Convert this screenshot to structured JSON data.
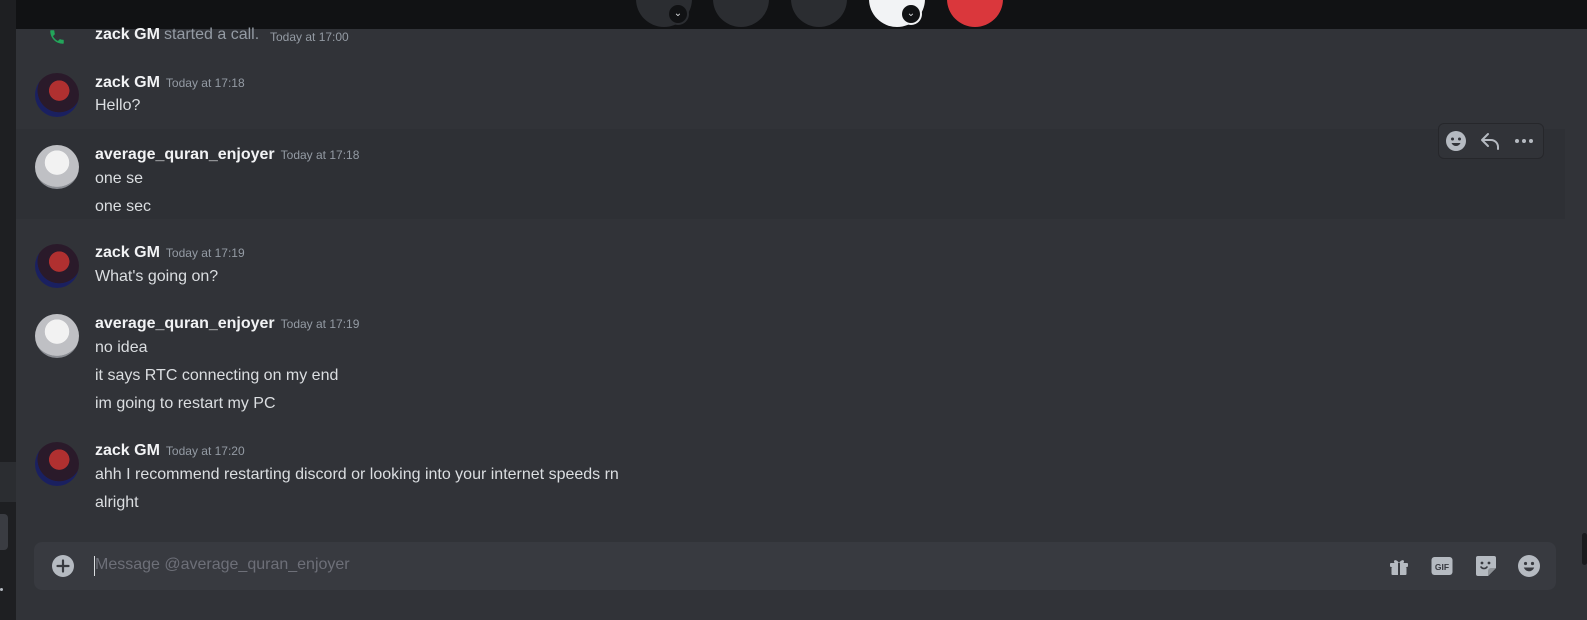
{
  "call": {
    "system_message": {
      "author": "zack GM",
      "action": "started a call.",
      "timestamp": "Today at 17:00"
    }
  },
  "messages": [
    {
      "author": "zack GM",
      "avatar": "zack-avatar",
      "timestamp": "Today at 17:18",
      "lines": [
        "Hello?"
      ]
    },
    {
      "author": "average_quran_enjoyer",
      "avatar": "quran-avatar",
      "timestamp": "Today at 17:18",
      "lines": [
        "one se",
        "one sec"
      ]
    },
    {
      "author": "zack GM",
      "avatar": "zack-avatar",
      "timestamp": "Today at 17:19",
      "lines": [
        "What's going on?"
      ]
    },
    {
      "author": "average_quran_enjoyer",
      "avatar": "quran-avatar",
      "timestamp": "Today at 17:19",
      "lines": [
        "no idea",
        "it says RTC connecting on my end",
        "im going to restart my PC"
      ]
    },
    {
      "author": "zack GM",
      "avatar": "zack-avatar",
      "timestamp": "Today at 17:20",
      "lines": [
        "ahh I recommend restarting discord or looking into your internet speeds rn",
        "alright"
      ]
    }
  ],
  "hover_actions": [
    "add-reaction-icon",
    "reply-icon",
    "more-icon"
  ],
  "composer": {
    "placeholder": "Message @average_quran_enjoyer",
    "gif_label": "GIF",
    "icons": [
      "add-attachment-icon",
      "gift-icon",
      "gif-icon",
      "sticker-icon",
      "emoji-icon"
    ]
  },
  "colors": {
    "background": "#313338",
    "call_bar": "#111214",
    "end_call": "#da373c",
    "call_icon": "#23a55a",
    "username": "#f2f3f5",
    "timestamp": "#949ba4"
  }
}
